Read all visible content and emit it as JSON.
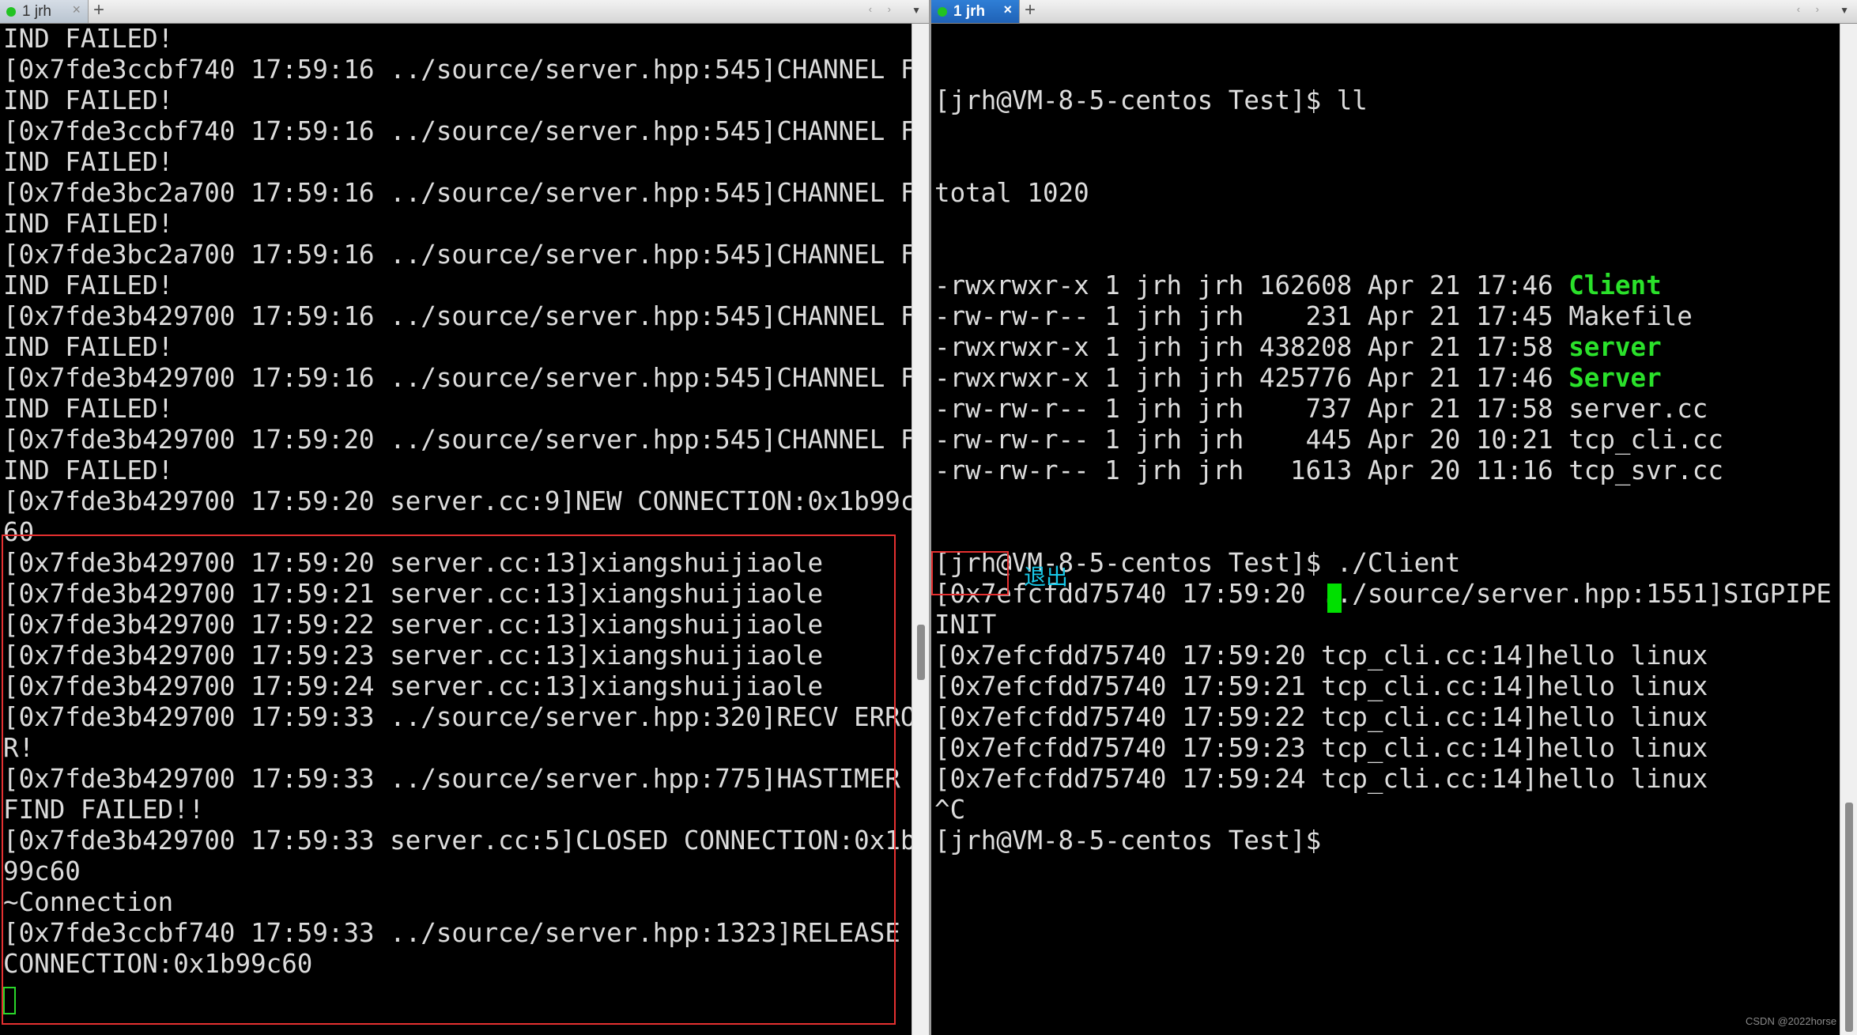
{
  "left_pane": {
    "tab": {
      "title": "1 jrh",
      "close": "×",
      "add": "+"
    },
    "nav": {
      "arrows": "‹ ›",
      "menu": "▼"
    },
    "lines": [
      "IND FAILED!",
      "[0x7fde3ccbf740 17:59:16 ../source/server.hpp:545]CHANNEL F",
      "IND FAILED!",
      "[0x7fde3ccbf740 17:59:16 ../source/server.hpp:545]CHANNEL F",
      "IND FAILED!",
      "[0x7fde3bc2a700 17:59:16 ../source/server.hpp:545]CHANNEL F",
      "IND FAILED!",
      "[0x7fde3bc2a700 17:59:16 ../source/server.hpp:545]CHANNEL F",
      "IND FAILED!",
      "[0x7fde3b429700 17:59:16 ../source/server.hpp:545]CHANNEL F",
      "IND FAILED!",
      "[0x7fde3b429700 17:59:16 ../source/server.hpp:545]CHANNEL F",
      "IND FAILED!",
      "[0x7fde3b429700 17:59:20 ../source/server.hpp:545]CHANNEL F",
      "IND FAILED!",
      "[0x7fde3b429700 17:59:20 server.cc:9]NEW CONNECTION:0x1b99c",
      "60",
      "[0x7fde3b429700 17:59:20 server.cc:13]xiangshuijiaole",
      "[0x7fde3b429700 17:59:21 server.cc:13]xiangshuijiaole",
      "[0x7fde3b429700 17:59:22 server.cc:13]xiangshuijiaole",
      "[0x7fde3b429700 17:59:23 server.cc:13]xiangshuijiaole",
      "[0x7fde3b429700 17:59:24 server.cc:13]xiangshuijiaole",
      "[0x7fde3b429700 17:59:33 ../source/server.hpp:320]RECV ERRO",
      "R!",
      "[0x7fde3b429700 17:59:33 ../source/server.hpp:775]HASTIMER",
      "FIND FAILED!!",
      "[0x7fde3b429700 17:59:33 server.cc:5]CLOSED CONNECTION:0x1b",
      "99c60",
      "~Connection",
      "[0x7fde3ccbf740 17:59:33 ../source/server.hpp:1323]RELEASE",
      "CONNECTION:0x1b99c60"
    ]
  },
  "right_pane": {
    "tab": {
      "title": "1 jrh",
      "close": "×",
      "add": "+"
    },
    "nav": {
      "arrows": "‹ ›",
      "menu": "▼"
    },
    "prompt_ll": "[jrh@VM-8-5-centos Test]$ ll",
    "total": "total 1020",
    "listing": [
      {
        "meta": "-rwxrwxr-x 1 jrh jrh 162608 Apr 21 17:46 ",
        "name": "Client",
        "exec": true
      },
      {
        "meta": "-rw-rw-r-- 1 jrh jrh    231 Apr 21 17:45 ",
        "name": "Makefile",
        "exec": false
      },
      {
        "meta": "-rwxrwxr-x 1 jrh jrh 438208 Apr 21 17:58 ",
        "name": "server",
        "exec": true
      },
      {
        "meta": "-rwxrwxr-x 1 jrh jrh 425776 Apr 21 17:46 ",
        "name": "Server",
        "exec": true
      },
      {
        "meta": "-rw-rw-r-- 1 jrh jrh    737 Apr 21 17:58 ",
        "name": "server.cc",
        "exec": false
      },
      {
        "meta": "-rw-rw-r-- 1 jrh jrh    445 Apr 20 10:21 ",
        "name": "tcp_cli.cc",
        "exec": false
      },
      {
        "meta": "-rw-rw-r-- 1 jrh jrh   1613 Apr 20 11:16 ",
        "name": "tcp_svr.cc",
        "exec": false
      }
    ],
    "after_listing": [
      "[jrh@VM-8-5-centos Test]$ ./Client",
      "[0x7efcfdd75740 17:59:20 ../source/server.hpp:1551]SIGPIPE",
      "INIT",
      "[0x7efcfdd75740 17:59:20 tcp_cli.cc:14]hello linux",
      "[0x7efcfdd75740 17:59:21 tcp_cli.cc:14]hello linux",
      "[0x7efcfdd75740 17:59:22 tcp_cli.cc:14]hello linux",
      "[0x7efcfdd75740 17:59:23 tcp_cli.cc:14]hello linux",
      "[0x7efcfdd75740 17:59:24 tcp_cli.cc:14]hello linux",
      "^C",
      "[jrh@VM-8-5-centos Test]$ "
    ],
    "annotation": "退出"
  },
  "watermark": "CSDN @2022horse",
  "colors": {
    "terminal_bg": "#000000",
    "terminal_fg": "#dcdcdc",
    "executable": "#2ae12a",
    "highlight_box": "#e53030",
    "annotation": "#18c8e8",
    "cursor": "#00e000",
    "active_tab": "#1f62b6"
  }
}
